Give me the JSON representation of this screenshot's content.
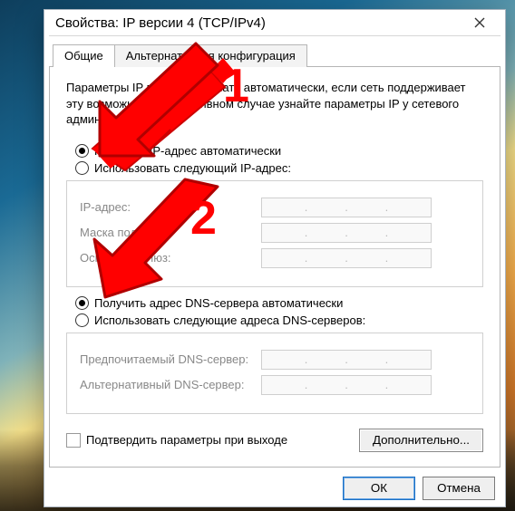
{
  "window": {
    "title": "Свойства: IP версии 4 (TCP/IPv4)"
  },
  "tabs": [
    {
      "label": "Общие"
    },
    {
      "label": "Альтернативная конфигурация"
    }
  ],
  "description": "Параметры IP можно назначать автоматически, если сеть поддерживает эту возможность. В противном случае узнайте параметры IP у сетевого администратора.",
  "ip_section": {
    "auto_label": "Получить IP-адрес автоматически",
    "manual_label": "Использовать следующий IP-адрес:",
    "rows": {
      "ip": "IP-адрес:",
      "mask": "Маска подсети:",
      "gateway": "Основной шлюз:"
    }
  },
  "dns_section": {
    "auto_label": "Получить адрес DNS-сервера автоматически",
    "manual_label": "Использовать следующие адреса DNS-серверов:",
    "rows": {
      "pref": "Предпочитаемый DNS-сервер:",
      "alt": "Альтернативный DNS-сервер:"
    }
  },
  "confirm_label": "Подтвердить параметры при выходе",
  "advanced_label": "Дополнительно...",
  "buttons": {
    "ok": "ОК",
    "cancel": "Отмена"
  },
  "annotations": {
    "one": "1",
    "two": "2"
  },
  "colors": {
    "annotation": "#ff0000"
  }
}
